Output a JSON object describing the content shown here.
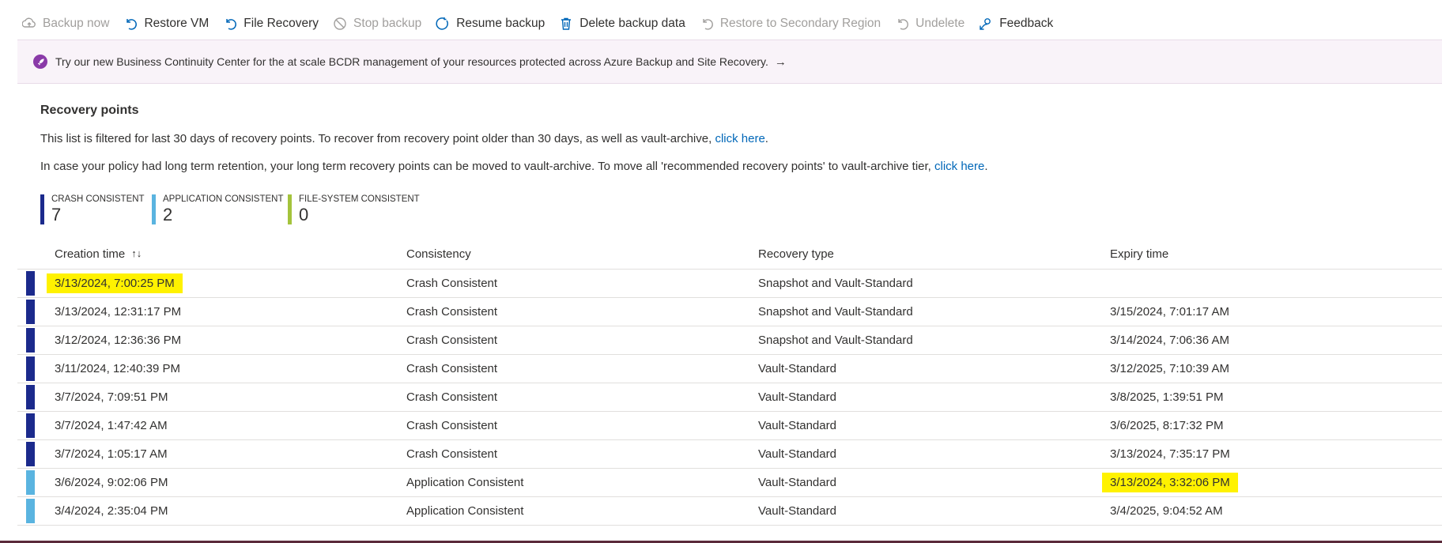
{
  "toolbar": {
    "items": [
      {
        "label": "Backup now",
        "icon": "backup-icon",
        "disabled": true
      },
      {
        "label": "Restore VM",
        "icon": "restore-icon",
        "disabled": false
      },
      {
        "label": "File Recovery",
        "icon": "file-recovery-icon",
        "disabled": false
      },
      {
        "label": "Stop backup",
        "icon": "stop-icon",
        "disabled": true
      },
      {
        "label": "Resume backup",
        "icon": "resume-icon",
        "disabled": false
      },
      {
        "label": "Delete backup data",
        "icon": "trash-icon",
        "disabled": false
      },
      {
        "label": "Restore to Secondary Region",
        "icon": "restore-secondary-icon",
        "disabled": true
      },
      {
        "label": "Undelete",
        "icon": "undelete-icon",
        "disabled": true
      },
      {
        "label": "Feedback",
        "icon": "feedback-icon",
        "disabled": false
      }
    ]
  },
  "banner": {
    "text": "Try our new Business Continuity Center for the at scale BCDR management of your resources protected across Azure Backup and Site Recovery.",
    "arrow": "→",
    "icon": "rocket-icon"
  },
  "recovery": {
    "title": "Recovery points",
    "info1_text": "This list is filtered for last 30 days of recovery points. To recover from recovery point older than 30 days, as well as vault-archive,",
    "info1_link": "click here",
    "info2_text": "In case your policy had long term retention, your long term recovery points can be moved to vault-archive. To move all 'recommended recovery points' to vault-archive tier,",
    "info2_link": "click here",
    "period": "."
  },
  "stats": {
    "crash": {
      "label": "CRASH CONSISTENT",
      "value": "7",
      "color": "#1b2a8c"
    },
    "app": {
      "label": "APPLICATION CONSISTENT",
      "value": "2",
      "color": "#5ab4e0"
    },
    "fs": {
      "label": "FILE-SYSTEM CONSISTENT",
      "value": "0",
      "color": "#a4c33c"
    }
  },
  "table": {
    "headers": [
      "Creation time",
      "Consistency",
      "Recovery type",
      "Expiry time"
    ],
    "sort_icon": "↑↓",
    "rows": [
      {
        "created": "3/13/2024, 7:00:25 PM",
        "consistency": "Crash Consistent",
        "type": "Snapshot and Vault-Standard",
        "expiry": "",
        "color": "#1b2a8c",
        "hl_created": true,
        "hl_expiry": false
      },
      {
        "created": "3/13/2024, 12:31:17 PM",
        "consistency": "Crash Consistent",
        "type": "Snapshot and Vault-Standard",
        "expiry": "3/15/2024, 7:01:17 AM",
        "color": "#1b2a8c",
        "hl_created": false,
        "hl_expiry": false
      },
      {
        "created": "3/12/2024, 12:36:36 PM",
        "consistency": "Crash Consistent",
        "type": "Snapshot and Vault-Standard",
        "expiry": "3/14/2024, 7:06:36 AM",
        "color": "#1b2a8c",
        "hl_created": false,
        "hl_expiry": false
      },
      {
        "created": "3/11/2024, 12:40:39 PM",
        "consistency": "Crash Consistent",
        "type": "Vault-Standard",
        "expiry": "3/12/2025, 7:10:39 AM",
        "color": "#1b2a8c",
        "hl_created": false,
        "hl_expiry": false
      },
      {
        "created": "3/7/2024, 7:09:51 PM",
        "consistency": "Crash Consistent",
        "type": "Vault-Standard",
        "expiry": "3/8/2025, 1:39:51 PM",
        "color": "#1b2a8c",
        "hl_created": false,
        "hl_expiry": false
      },
      {
        "created": "3/7/2024, 1:47:42 AM",
        "consistency": "Crash Consistent",
        "type": "Vault-Standard",
        "expiry": "3/6/2025, 8:17:32 PM",
        "color": "#1b2a8c",
        "hl_created": false,
        "hl_expiry": false
      },
      {
        "created": "3/7/2024, 1:05:17 AM",
        "consistency": "Crash Consistent",
        "type": "Vault-Standard",
        "expiry": "3/13/2024, 7:35:17 PM",
        "color": "#1b2a8c",
        "hl_created": false,
        "hl_expiry": false
      },
      {
        "created": "3/6/2024, 9:02:06 PM",
        "consistency": "Application Consistent",
        "type": "Vault-Standard",
        "expiry": "3/13/2024, 3:32:06 PM",
        "color": "#5ab4e0",
        "hl_created": false,
        "hl_expiry": true
      },
      {
        "created": "3/4/2024, 2:35:04 PM",
        "consistency": "Application Consistent",
        "type": "Vault-Standard",
        "expiry": "3/4/2025, 9:04:52 AM",
        "color": "#5ab4e0",
        "hl_created": false,
        "hl_expiry": false
      }
    ]
  }
}
